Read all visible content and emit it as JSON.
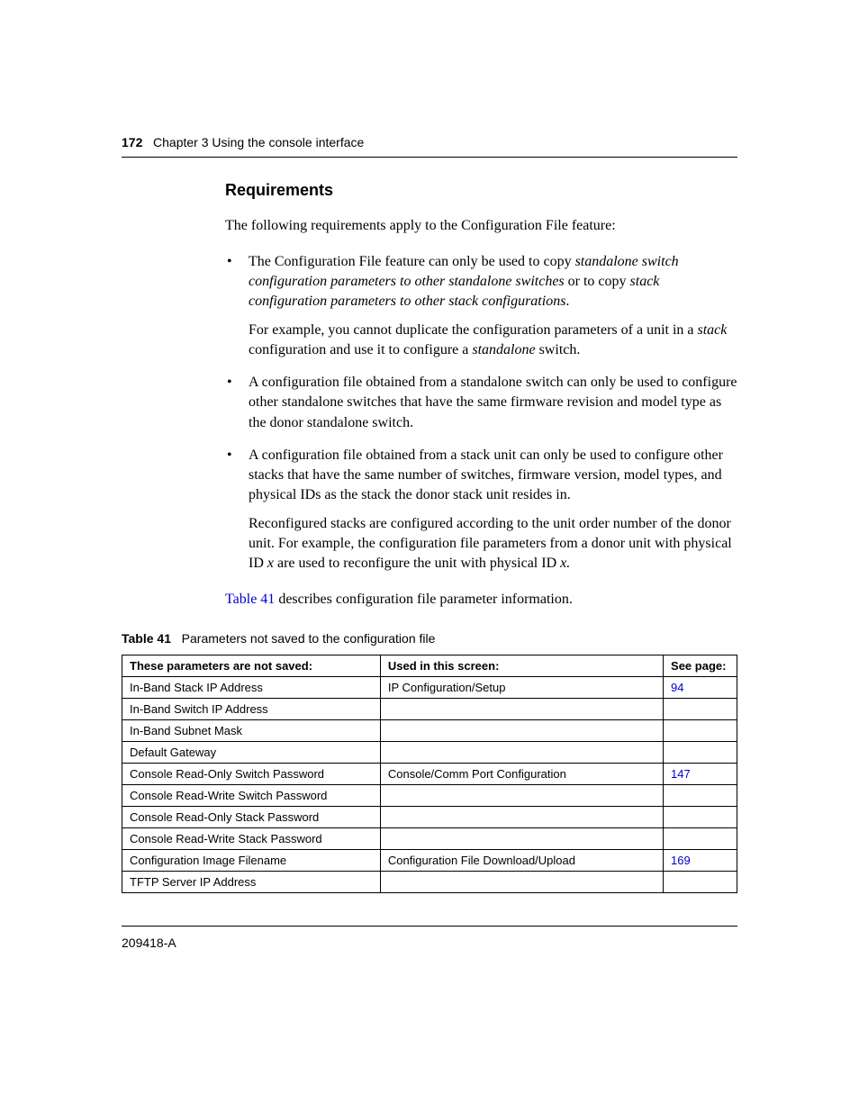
{
  "header": {
    "page_number": "172",
    "chapter": "Chapter 3  Using the console interface"
  },
  "heading": "Requirements",
  "intro": "The following requirements apply to the Configuration File feature:",
  "bullets": {
    "b1_pre": "The Configuration File feature can only be used to copy ",
    "b1_i1": "standalone switch configuration parameters to other standalone switches",
    "b1_mid": " or to copy ",
    "b1_i2": "stack configuration parameters to other stack configurations",
    "b1_post": ".",
    "b1_sub_pre": "For example, you cannot duplicate the configuration parameters of a unit in a ",
    "b1_sub_i1": "stack",
    "b1_sub_mid": " configuration and use it to configure a ",
    "b1_sub_i2": "standalone",
    "b1_sub_post": " switch.",
    "b2": "A configuration file obtained from a standalone switch can only be used to configure other standalone switches that have the same firmware revision and model type as the donor standalone switch.",
    "b3": "A configuration file obtained from a stack unit can only be used to configure other stacks that have the same number of switches, firmware version, model types, and physical IDs as the stack the donor stack unit resides in.",
    "b3_sub_pre": "Reconfigured stacks are configured according to the unit order number of the donor unit. For example, the configuration file parameters from a donor unit with physical ID ",
    "b3_sub_x1": "x",
    "b3_sub_mid": " are used to reconfigure the unit with physical ID ",
    "b3_sub_x2": "x.",
    "b3_sub_post": ""
  },
  "afterlist": {
    "link": "Table 41",
    "rest": " describes configuration file parameter information."
  },
  "table": {
    "label": "Table 41",
    "caption": "Parameters not saved to the configuration file",
    "headers": {
      "c1": "These parameters are not saved:",
      "c2": "Used in this screen:",
      "c3": "See page:"
    },
    "rows": [
      {
        "c1": "In-Band Stack IP Address",
        "c2": "IP Configuration/Setup",
        "c3": "94",
        "link": true
      },
      {
        "c1": "In-Band Switch IP Address",
        "c2": "",
        "c3": "",
        "link": false
      },
      {
        "c1": "In-Band Subnet Mask",
        "c2": "",
        "c3": "",
        "link": false
      },
      {
        "c1": "Default Gateway",
        "c2": "",
        "c3": "",
        "link": false
      },
      {
        "c1": "Console Read-Only Switch Password",
        "c2": "Console/Comm Port Configuration",
        "c3": "147",
        "link": true
      },
      {
        "c1": "Console Read-Write Switch Password",
        "c2": "",
        "c3": "",
        "link": false
      },
      {
        "c1": "Console Read-Only Stack Password",
        "c2": "",
        "c3": "",
        "link": false
      },
      {
        "c1": "Console Read-Write Stack Password",
        "c2": "",
        "c3": "",
        "link": false
      },
      {
        "c1": "Configuration Image Filename",
        "c2": "Configuration File Download/Upload",
        "c3": "169",
        "link": true
      },
      {
        "c1": "TFTP Server IP Address",
        "c2": "",
        "c3": "",
        "link": false
      }
    ]
  },
  "footer": "209418-A"
}
